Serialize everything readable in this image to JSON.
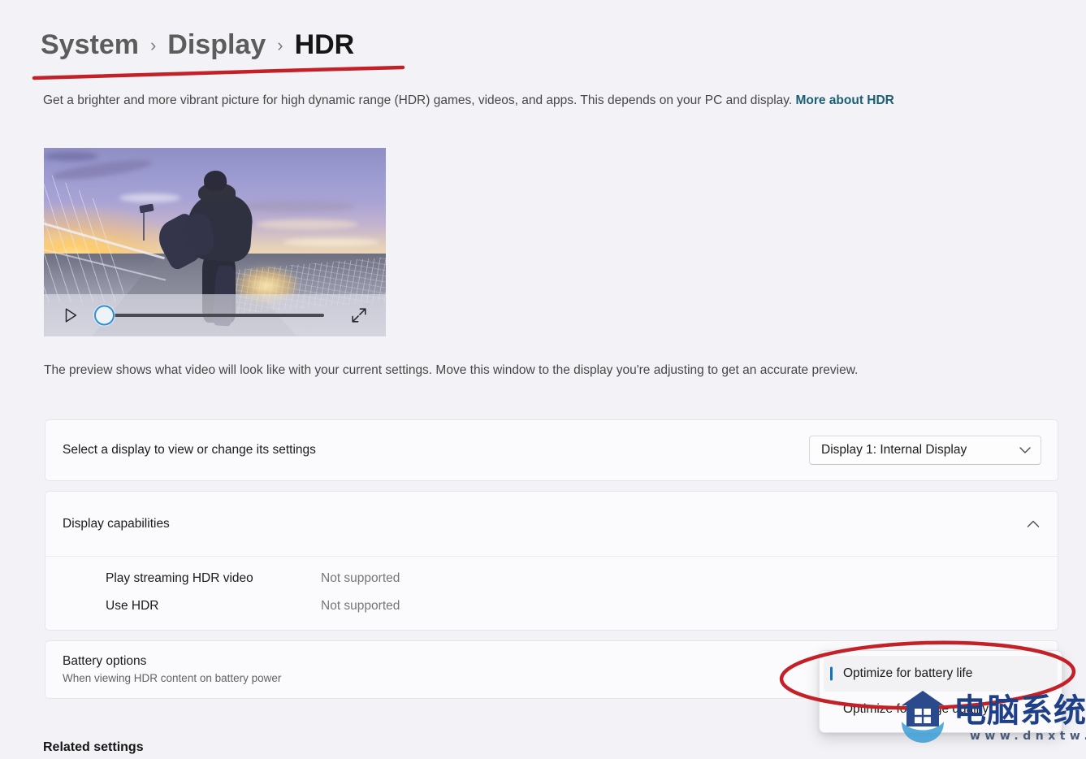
{
  "breadcrumb": {
    "system": "System",
    "display": "Display",
    "current": "HDR",
    "separator": "›"
  },
  "description": {
    "text": "Get a brighter and more vibrant picture for high dynamic range (HDR) games, videos, and apps. This depends on your PC and display. ",
    "link": "More about HDR"
  },
  "video": {
    "play_label": "Play",
    "expand_label": "Full screen",
    "progress_percent": 0
  },
  "preview_caption": "The preview shows what video will look like with your current settings. Move this window to the display you're adjusting to get an accurate preview.",
  "display_select": {
    "label": "Select a display to view or change its settings",
    "selected": "Display 1: Internal Display",
    "chevron": "⌄"
  },
  "capabilities": {
    "title": "Display capabilities",
    "expanded": true,
    "rows": [
      {
        "name": "Play streaming HDR video",
        "value": "Not supported"
      },
      {
        "name": "Use HDR",
        "value": "Not supported"
      }
    ]
  },
  "battery": {
    "title": "Battery options",
    "subtitle": "When viewing HDR content on battery power"
  },
  "battery_flyout": {
    "items": [
      {
        "label": "Optimize for battery life",
        "selected": true
      },
      {
        "label": "Optimize for image quality",
        "selected": false
      }
    ]
  },
  "related_settings": {
    "title": "Related settings"
  },
  "watermark": {
    "site_name": "电脑系统网",
    "url": "www.dnxtw.com"
  },
  "colors": {
    "page_background": "#f3f3f7",
    "card_background": "#fbfbfd",
    "link": "#1a5f73",
    "accent_selected": "#1273bd",
    "annotation_red": "#c32027",
    "slider_ring": "#2d8fd5",
    "watermark_blue": "#1f3f87"
  }
}
